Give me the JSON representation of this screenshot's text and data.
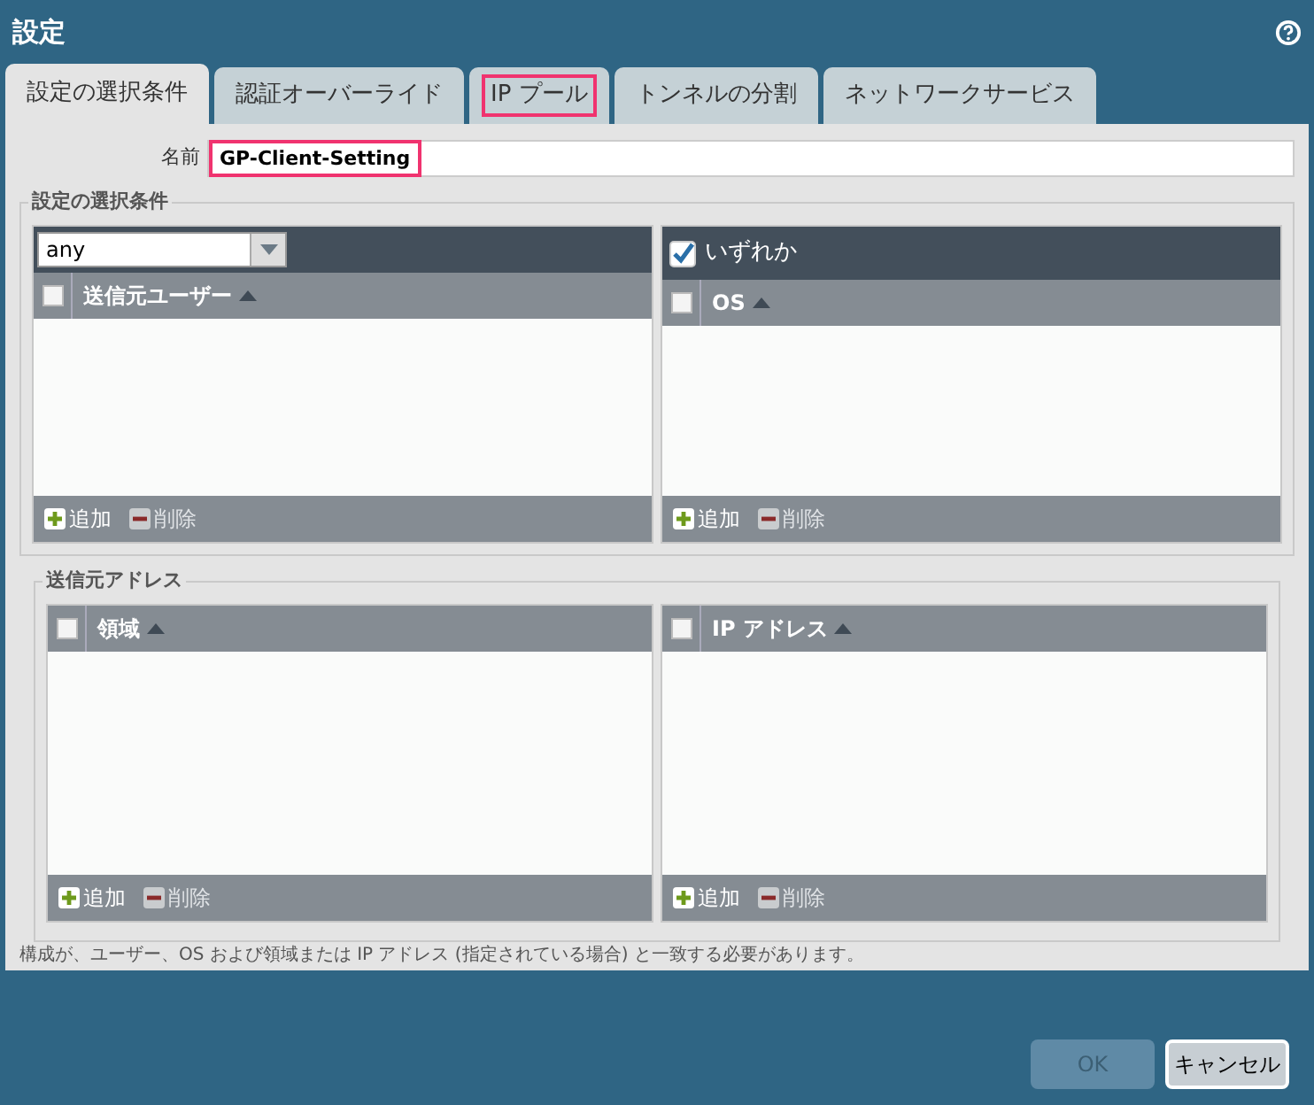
{
  "window": {
    "title": "設定"
  },
  "tabs": [
    {
      "label": "設定の選択条件",
      "selected": true,
      "highlighted": false
    },
    {
      "label": "認証オーバーライド",
      "selected": false,
      "highlighted": false
    },
    {
      "label": "IP プール",
      "selected": false,
      "highlighted": true
    },
    {
      "label": "トンネルの分割",
      "selected": false,
      "highlighted": false
    },
    {
      "label": "ネットワークサービス",
      "selected": false,
      "highlighted": false
    }
  ],
  "name_field": {
    "label": "名前",
    "value": "GP-Client-Setting",
    "highlighted": true
  },
  "sections": [
    {
      "title": "設定の選択条件",
      "grids": [
        {
          "kind": "dropdown",
          "dropdown_value": "any",
          "column": "送信元ユーザー",
          "column_checked": false,
          "add": "追加",
          "delete": "削除",
          "delete_disabled": true
        },
        {
          "kind": "checkbox",
          "checkbox_label": "いずれか",
          "checked": true,
          "column": "OS",
          "column_checked": false,
          "add": "追加",
          "delete": "削除",
          "delete_disabled": true
        }
      ]
    },
    {
      "title": "送信元アドレス",
      "grids": [
        {
          "kind": "plain",
          "column": "領域",
          "column_checked": false,
          "add": "追加",
          "delete": "削除",
          "delete_disabled": true
        },
        {
          "kind": "plain",
          "column": "IP アドレス",
          "column_checked": false,
          "add": "追加",
          "delete": "削除",
          "delete_disabled": true
        }
      ]
    }
  ],
  "note": "構成が、ユーザー、OS および領域または IP アドレス (指定されている場合) と一致する必要があります。",
  "buttons": [
    {
      "label": "OK",
      "disabled": true
    },
    {
      "label": "キャンセル",
      "disabled": false
    }
  ]
}
